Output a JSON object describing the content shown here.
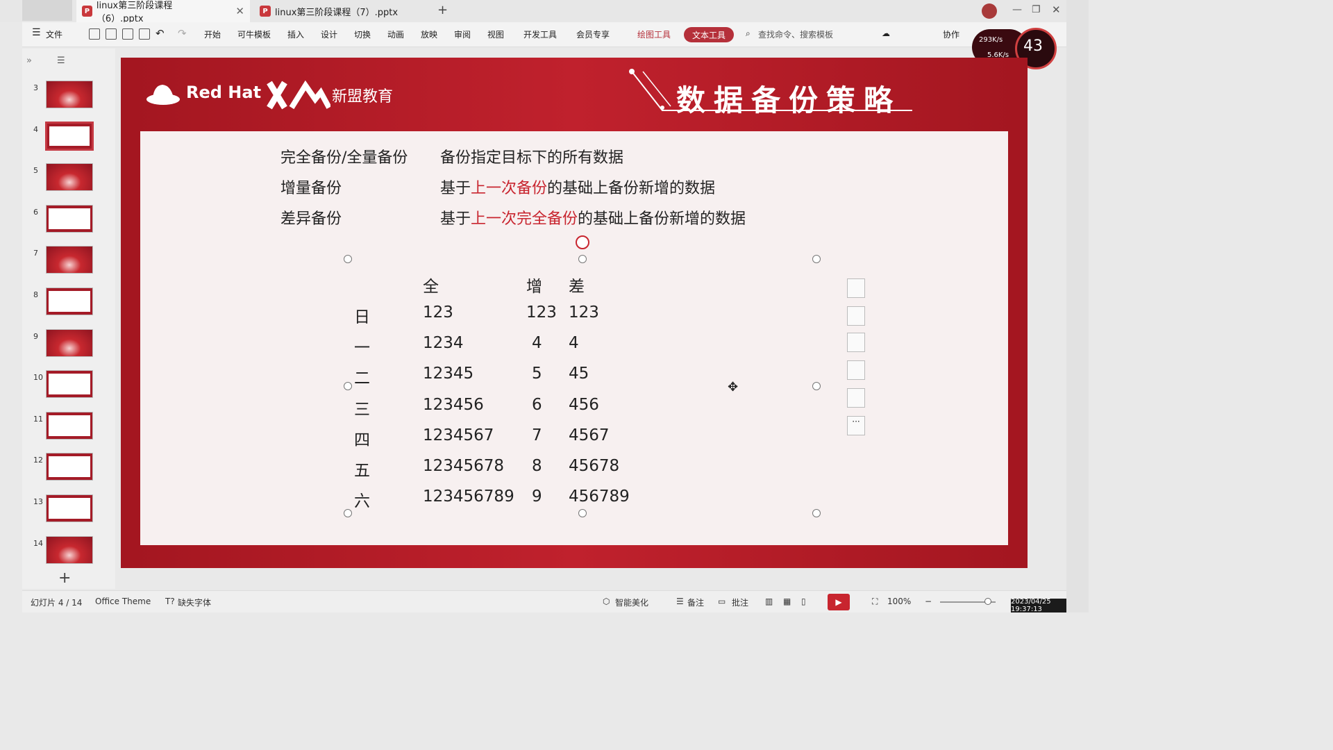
{
  "tabs": [
    {
      "label": "linux第三阶段课程（6）.pptx",
      "active": true
    },
    {
      "label": "linux第三阶段课程（7）.pptx",
      "active": false
    }
  ],
  "new_tab": "+",
  "ribbon": {
    "file": "文件",
    "menus": [
      "开始",
      "可牛模板",
      "插入",
      "设计",
      "切换",
      "动画",
      "放映",
      "审阅",
      "视图",
      "开发工具",
      "会员专享"
    ],
    "drawing_tools": "绘图工具",
    "text_tools": "文本工具",
    "search": "查找命令、搜索模板",
    "collab": "协作"
  },
  "net": {
    "up": "293K/s",
    "down": "5.6K/s",
    "percent": "43"
  },
  "thumbnails": [
    {
      "num": "3",
      "style": "red"
    },
    {
      "num": "4",
      "style": "white",
      "selected": true
    },
    {
      "num": "5",
      "style": "red"
    },
    {
      "num": "6",
      "style": "white"
    },
    {
      "num": "7",
      "style": "red"
    },
    {
      "num": "8",
      "style": "white"
    },
    {
      "num": "9",
      "style": "red"
    },
    {
      "num": "10",
      "style": "white"
    },
    {
      "num": "11",
      "style": "white"
    },
    {
      "num": "12",
      "style": "white"
    },
    {
      "num": "13",
      "style": "white"
    },
    {
      "num": "14",
      "style": "red"
    }
  ],
  "slide": {
    "brand1": "Red Hat",
    "brand2": "新盟教育",
    "title": "数据备份策略",
    "defs": [
      {
        "term": "完全备份/全量备份",
        "pre": "备份指定目标下的所有数据",
        "hl": "",
        "post": ""
      },
      {
        "term": "增量备份",
        "pre": "基于",
        "hl": "上一次备份",
        "post": "的基础上备份新增的数据"
      },
      {
        "term": "差异备份",
        "pre": "基于",
        "hl": "上一次完全备份",
        "post": "的基础上备份新增的数据"
      }
    ],
    "table": {
      "headers": [
        "",
        "全",
        "增",
        "差"
      ],
      "rows": [
        [
          "日",
          "123",
          "123",
          "123"
        ],
        [
          "一",
          "1234",
          "4",
          "4"
        ],
        [
          "二",
          "12345",
          "5",
          "45"
        ],
        [
          "三",
          "123456",
          "6",
          "456"
        ],
        [
          "四",
          "1234567",
          "7",
          "4567"
        ],
        [
          "五",
          "12345678",
          "8",
          "45678"
        ],
        [
          "六",
          "123456789",
          "9",
          "456789"
        ]
      ]
    }
  },
  "status": {
    "slide_info": "幻灯片 4 / 14",
    "theme": "Office Theme",
    "missing_font": "缺失字体",
    "beautify": "智能美化",
    "notes": "备注",
    "comments": "批注",
    "zoom": "100%"
  },
  "clock": "2023/04/25 19:37:13",
  "colors": {
    "slide_red": "#b81c28",
    "accent": "#c8252f"
  }
}
